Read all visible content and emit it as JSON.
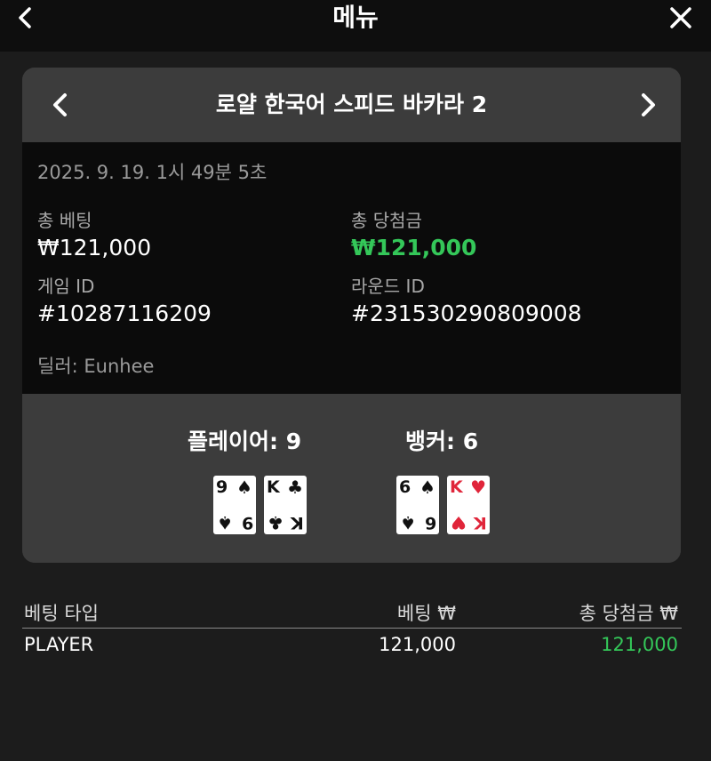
{
  "topbar": {
    "title": "메뉴",
    "back_icon": "chevron-left-icon",
    "close_icon": "close-icon"
  },
  "card": {
    "game_title": "로얄 한국어 스피드 바카라 2",
    "date": "2025. 9. 19. 1시 49분 5초",
    "total_bet_label": "총 베팅",
    "total_bet_value": "₩121,000",
    "total_win_label": "총 당첨금",
    "total_win_value": "₩121,000",
    "game_id_label": "게임 ID",
    "game_id_value": "#10287116209",
    "round_id_label": "라운드 ID",
    "round_id_value": "#231530290809008",
    "dealer": "딜러: Eunhee",
    "player_label": "플레이어: 9",
    "banker_label": "뱅커: 6",
    "player_cards": [
      {
        "rank": "9",
        "suit": "♠",
        "color": "#111111"
      },
      {
        "rank": "K",
        "suit": "♣",
        "color": "#111111"
      }
    ],
    "banker_cards": [
      {
        "rank": "6",
        "suit": "♠",
        "color": "#111111"
      },
      {
        "rank": "K",
        "suit": "♥",
        "color": "#e0253a"
      }
    ]
  },
  "table": {
    "headers": [
      "베팅 타입",
      "베팅 ₩",
      "총 당첨금 ₩"
    ],
    "rows": [
      {
        "type": "PLAYER",
        "bet": "121,000",
        "win": "121,000"
      }
    ]
  },
  "colors": {
    "win": "#34c759",
    "background": "#1c1c1c"
  }
}
